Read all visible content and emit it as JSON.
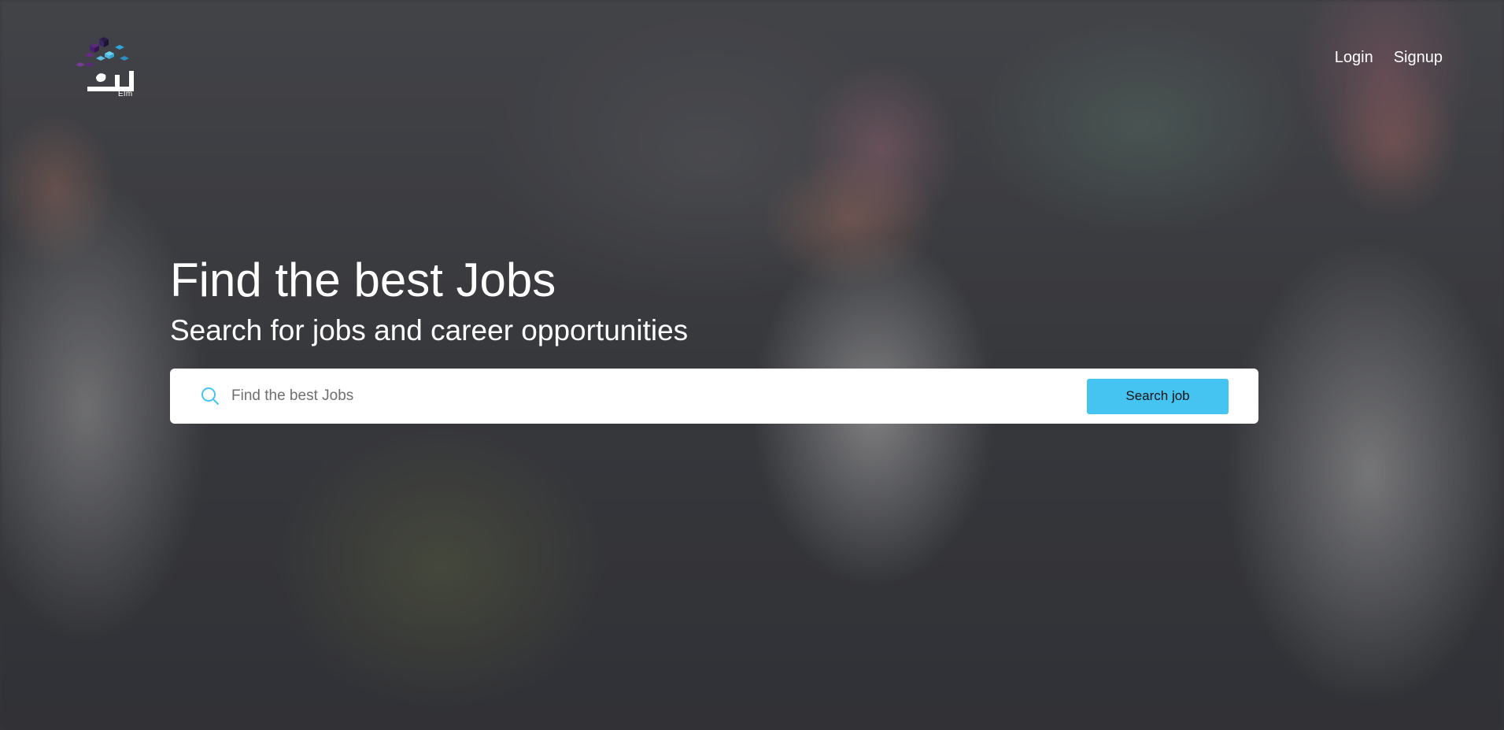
{
  "brand": {
    "logo_icon": "elm-logo-icon",
    "name_latin": "Elm",
    "colors": {
      "purple": "#4a1f6b",
      "blue": "#2fa6d6",
      "light_blue": "#6fd1f5",
      "dark": "#2a1d45"
    }
  },
  "nav": {
    "login_label": "Login",
    "signup_label": "Signup"
  },
  "hero": {
    "title": "Find the best Jobs",
    "subtitle": "Search for jobs and career opportunities"
  },
  "search": {
    "icon": "search-icon",
    "placeholder": "Find the best Jobs",
    "value": "",
    "button_label": "Search job",
    "button_color": "#45c4f2"
  }
}
